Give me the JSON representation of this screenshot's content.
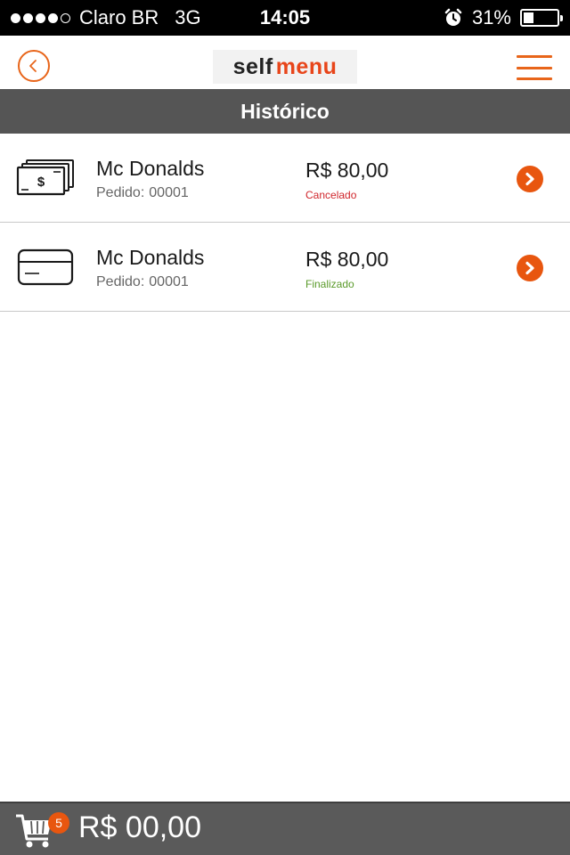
{
  "status_bar": {
    "signal_dots": 5,
    "signal_filled": 4,
    "carrier": "Claro BR",
    "network": "3G",
    "time": "14:05",
    "alarm_icon": "alarm-clock-icon",
    "battery_percent": "31%",
    "battery_level": 0.31
  },
  "navbar": {
    "back_icon": "chevron-left-icon",
    "logo_self": "self",
    "logo_menu": "menu",
    "menu_icon": "hamburger-icon",
    "accent_color": "#e8651a"
  },
  "section": {
    "title": "Histórico",
    "bg_color": "#555555"
  },
  "orders": [
    {
      "payment_icon": "cash-icon",
      "merchant": "Mc Donalds",
      "order_label": "Pedido:",
      "order_number": "00001",
      "price": "R$ 80,00",
      "status": "Cancelado",
      "status_color": "#d0252b"
    },
    {
      "payment_icon": "credit-card-icon",
      "merchant": "Mc Donalds",
      "order_label": "Pedido:",
      "order_number": "00001",
      "price": "R$ 80,00",
      "status": "Finalizado",
      "status_color": "#5a9a2a"
    }
  ],
  "bottom_bar": {
    "cart_icon": "shopping-cart-icon",
    "cart_count": "5",
    "total": "R$ 00,00"
  }
}
